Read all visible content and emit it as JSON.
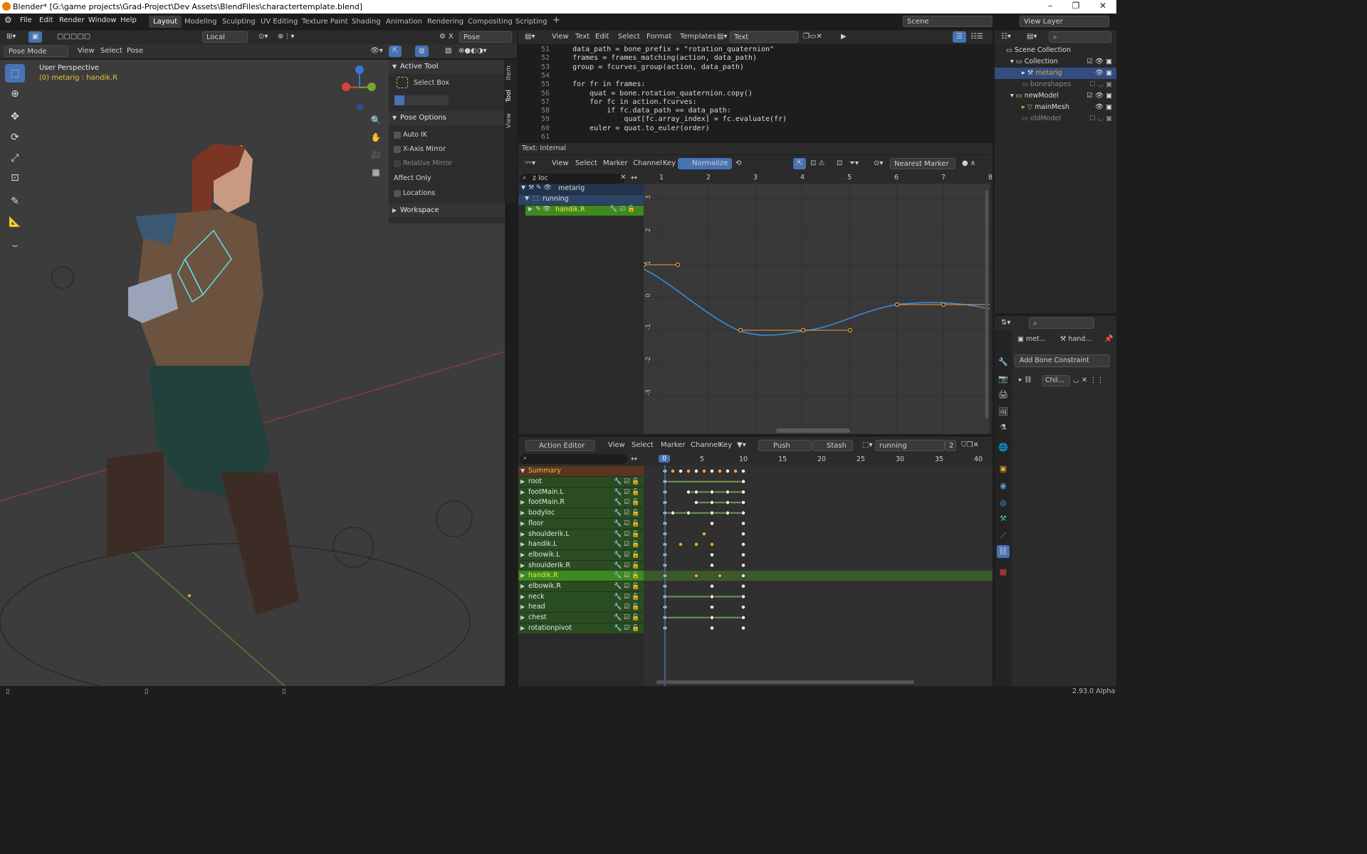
{
  "window": {
    "title": "Blender* [G:\\game projects\\Grad-Project\\Dev Assets\\BlendFiles\\charactertemplate.blend]"
  },
  "menus": [
    "File",
    "Edit",
    "Render",
    "Window",
    "Help"
  ],
  "workspaces": [
    "Layout",
    "Modeling",
    "Sculpting",
    "UV Editing",
    "Texture Paint",
    "Shading",
    "Animation",
    "Rendering",
    "Compositing",
    "Scripting"
  ],
  "scene": "Scene",
  "view_layer": "View Layer",
  "viewport": {
    "transform_space": "Local",
    "pose_options": "Pose Options",
    "mode": "Pose Mode",
    "menu": [
      "View",
      "Select",
      "Pose"
    ],
    "info_title": "User Perspective",
    "info_sub": "(0) metarig : handik.R",
    "close_x": "X"
  },
  "npanel": {
    "active_tool": "Active Tool",
    "select_box": "Select Box",
    "pose_options": "Pose Options",
    "auto_ik": "Auto IK",
    "x_mirror": "X-Axis Mirror",
    "rel_mirror": "Relative Mirror",
    "affect_only": "Affect Only",
    "locations": "Locations",
    "workspace": "Workspace",
    "tabs": [
      "Item",
      "Tool",
      "View"
    ]
  },
  "text_editor": {
    "menu": [
      "View",
      "Text",
      "Edit",
      "Select",
      "Format",
      "Templates"
    ],
    "file": "Text",
    "status": "Text: Internal",
    "lines": [
      {
        "n": "51",
        "code": "    data_path = bone_prefix + \"rotation_quaternion\""
      },
      {
        "n": "52",
        "code": "    frames = frames_matching(action, data_path)"
      },
      {
        "n": "53",
        "code": "    group = fcurves_group(action, data_path)"
      },
      {
        "n": "54",
        "code": ""
      },
      {
        "n": "55",
        "code": "    for fr in frames:"
      },
      {
        "n": "56",
        "code": "        quat = bone.rotation_quaternion.copy()"
      },
      {
        "n": "57",
        "code": "        for fc in action.fcurves:"
      },
      {
        "n": "58",
        "code": "            if fc.data_path == data_path:"
      },
      {
        "n": "59",
        "code": "                quat[fc.array_index] = fc.evaluate(fr)"
      },
      {
        "n": "60",
        "code": "        euler = quat.to_euler(order)"
      },
      {
        "n": "61",
        "code": ""
      }
    ]
  },
  "graph_editor": {
    "menu": [
      "View",
      "Select",
      "Marker",
      "Channel",
      "Key"
    ],
    "normalize": "Normalize",
    "snap": "Nearest Marker",
    "search": "z loc",
    "channels": [
      "metarig",
      "running",
      "handik.R"
    ],
    "xticks": [
      "1",
      "2",
      "3",
      "4",
      "5",
      "6",
      "7",
      "8"
    ],
    "yticks": [
      "3",
      "2",
      "1",
      "0",
      "-1",
      "-2",
      "-3"
    ]
  },
  "action_editor": {
    "mode": "Action Editor",
    "menu": [
      "View",
      "Select",
      "Marker",
      "Channel",
      "Key"
    ],
    "push_down": "Push Down",
    "stash": "Stash",
    "action": "running",
    "users": "2",
    "frame": "0",
    "xticks": [
      "5",
      "10",
      "15",
      "20",
      "25",
      "30",
      "35",
      "40"
    ],
    "summary": "Summary",
    "channels": [
      "root",
      "footMain.L",
      "footMain.R",
      "bodyloc",
      "floor",
      "shoulderik.L",
      "handik.L",
      "elbowik.L",
      "shoulderik.R",
      "handik.R",
      "elbowik.R",
      "neck",
      "head",
      "chest",
      "rotationpivot"
    ]
  },
  "outliner": {
    "root": "Scene Collection",
    "items": [
      "Collection",
      "metarig",
      "boneshapes",
      "newModel",
      "mainMesh",
      "oldModel"
    ]
  },
  "properties": {
    "obj": "met...",
    "bone": "hand...",
    "add_constraint": "Add Bone Constraint",
    "constraint": "Chil..."
  },
  "status": {
    "version": "2.93.0 Alpha"
  },
  "colors": {
    "accent": "#4772b3",
    "channel_green": "#294d20",
    "selected_green": "#3d8a1f",
    "keyframe": "#e8a33c",
    "curve": "#3a8ee6"
  }
}
